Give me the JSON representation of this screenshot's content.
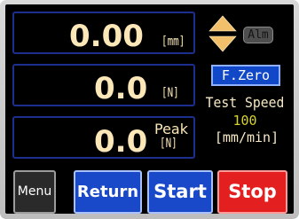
{
  "displacement": {
    "value": "0.00",
    "unit": "[mm]"
  },
  "force": {
    "value": "0.0",
    "unit": "[N]"
  },
  "peak": {
    "value": "0.0",
    "label": "Peak",
    "unit": "[N]"
  },
  "alarm_label": "Alm",
  "fzero_label": "F.Zero",
  "test_speed": {
    "label": "Test Speed",
    "value": "100",
    "unit": "[mm/min]"
  },
  "buttons": {
    "menu": "Menu",
    "return": "Return",
    "start": "Start",
    "stop": "Stop"
  },
  "colors": {
    "readout_text": "#fbe7b7",
    "readout_border": "#1c2f8f",
    "arrow_fill": "#f2c06a",
    "blue_button": "#1948c8",
    "stop_button": "#e41f1f",
    "speed_value": "#d8d32a"
  },
  "icons": {
    "direction": "up-down-arrows-icon"
  }
}
